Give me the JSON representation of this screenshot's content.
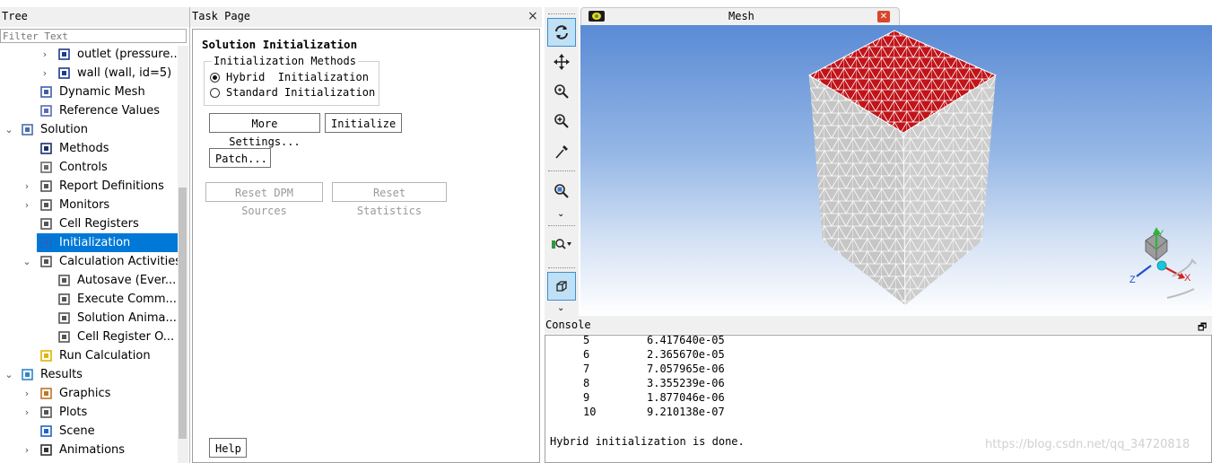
{
  "tree": {
    "title": "Tree",
    "filter_placeholder": "Filter Text",
    "items": [
      {
        "label": "outlet (pressure...",
        "icon": "boundary-icon",
        "level": 2,
        "arrow": "›"
      },
      {
        "label": "wall (wall, id=5)",
        "icon": "boundary-icon",
        "level": 2,
        "arrow": "›"
      },
      {
        "label": "Dynamic Mesh",
        "icon": "dynamic-mesh-icon",
        "level": 1,
        "arrow": ""
      },
      {
        "label": "Reference Values",
        "icon": "reference-values-icon",
        "level": 1,
        "arrow": ""
      },
      {
        "label": "Solution",
        "icon": "solution-icon",
        "level": 0,
        "arrow": "⌄"
      },
      {
        "label": "Methods",
        "icon": "methods-icon",
        "level": 1,
        "arrow": ""
      },
      {
        "label": "Controls",
        "icon": "controls-icon",
        "level": 1,
        "arrow": ""
      },
      {
        "label": "Report Definitions",
        "icon": "report-icon",
        "level": 1,
        "arrow": "›"
      },
      {
        "label": "Monitors",
        "icon": "monitors-icon",
        "level": 1,
        "arrow": "›"
      },
      {
        "label": "Cell Registers",
        "icon": "cell-registers-icon",
        "level": 1,
        "arrow": ""
      },
      {
        "label": "Initialization",
        "icon": "initialization-icon",
        "level": 1,
        "arrow": "",
        "selected": true
      },
      {
        "label": "Calculation Activities",
        "icon": "calc-activities-icon",
        "level": 1,
        "arrow": "⌄"
      },
      {
        "label": "Autosave (Ever...",
        "icon": "activity-icon",
        "level": 2,
        "arrow": ""
      },
      {
        "label": "Execute Comm...",
        "icon": "activity-icon",
        "level": 2,
        "arrow": ""
      },
      {
        "label": "Solution Anima...",
        "icon": "activity-icon",
        "level": 2,
        "arrow": ""
      },
      {
        "label": "Cell Register O...",
        "icon": "activity-icon",
        "level": 2,
        "arrow": ""
      },
      {
        "label": "Run Calculation",
        "icon": "run-calculation-icon",
        "level": 1,
        "arrow": ""
      },
      {
        "label": "Results",
        "icon": "results-icon",
        "level": 0,
        "arrow": "⌄"
      },
      {
        "label": "Graphics",
        "icon": "graphics-icon",
        "level": 1,
        "arrow": "›"
      },
      {
        "label": "Plots",
        "icon": "plots-icon",
        "level": 1,
        "arrow": "›"
      },
      {
        "label": "Scene",
        "icon": "scene-icon",
        "level": 1,
        "arrow": ""
      },
      {
        "label": "Animations",
        "icon": "animations-icon",
        "level": 1,
        "arrow": "›"
      }
    ]
  },
  "task": {
    "title": "Task Page",
    "close": "×",
    "heading": "Solution Initialization",
    "group_label": "Initialization Methods",
    "radio_hybrid": "Hybrid  Initialization",
    "radio_standard": "Standard Initialization",
    "selected_method": "hybrid",
    "more_settings": "More Settings...",
    "initialize": "Initialize",
    "patch": "Patch...",
    "reset_dpm": "Reset DPM Sources",
    "reset_stats": "Reset Statistics",
    "help": "Help"
  },
  "toolbar": {
    "icons": [
      "rotate-icon",
      "pan-icon",
      "zoom-in-out-icon",
      "zoom-box-icon",
      "probe-icon",
      "fit-to-window-icon",
      "more-chevron-icon",
      "views-icon",
      "orthographic-icon",
      "more-chevron-icon"
    ]
  },
  "mesh_tab": {
    "title": "Mesh",
    "close": "✕"
  },
  "triad": {
    "x": "X",
    "y": "Y",
    "z": "Z"
  },
  "colors": {
    "selected_row": "#0078d7",
    "mesh_top_face": "#c0141a",
    "mesh_side_face": "#c8c8c8"
  },
  "console": {
    "title": "Console",
    "restore": "🗗",
    "rows": [
      {
        "iter": "5",
        "value": "6.417640e-05"
      },
      {
        "iter": "6",
        "value": "2.365670e-05"
      },
      {
        "iter": "7",
        "value": "7.057965e-06"
      },
      {
        "iter": "8",
        "value": "3.355239e-06"
      },
      {
        "iter": "9",
        "value": "1.877046e-06"
      },
      {
        "iter": "10",
        "value": "9.210138e-07"
      }
    ],
    "message": "Hybrid initialization is done."
  },
  "watermark": "https://blog.csdn.net/qq_34720818"
}
